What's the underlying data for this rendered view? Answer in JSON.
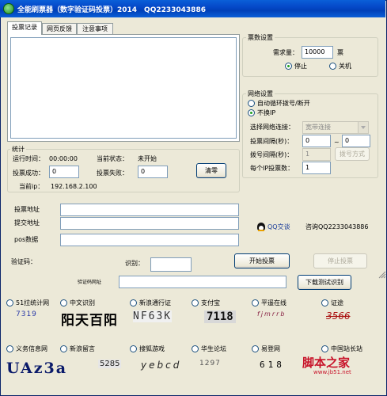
{
  "window": {
    "title": "全能刷票器（数字验证码投票）2014　QQ2233043886"
  },
  "tabs": [
    {
      "label": "投票记录"
    },
    {
      "label": "网页反馈"
    },
    {
      "label": "注意事项"
    }
  ],
  "vote_settings": {
    "title": "票数设置",
    "required_label": "需求量：",
    "required_value": "10000",
    "unit": "票",
    "opt_stop": "停止",
    "opt_shutdown": "关机"
  },
  "network": {
    "title": "网络设置",
    "opt_auto_redial": "自动循环拨号/断开",
    "opt_no_ip_change": "不换IP",
    "select_label": "选择网络连接：",
    "select_value": "宽带连接",
    "interval_label": "投票间隔(秒)：",
    "interval_from": "0",
    "tilde": "~",
    "interval_to": "0",
    "dial_label": "拨号间隔(秒)：",
    "dial_value": "1",
    "dial_mode_button": "拨号方式",
    "per_ip_label": "每个IP投票数：",
    "per_ip_value": "1"
  },
  "stats": {
    "title": "统计",
    "runtime_label": "运行时间：",
    "runtime_value": "00:00:00",
    "state_label": "当前状态：",
    "state_value": "未开始",
    "success_label": "投票成功：",
    "success_value": "0",
    "fail_label": "投票失败：",
    "fail_value": "0",
    "clear_button": "清零",
    "ip_label": "当前ip：",
    "ip_value": "192.168.2.100"
  },
  "form": {
    "vote_url_label": "投票地址",
    "vote_url_value": "",
    "submit_url_label": "提交地址",
    "submit_url_value": "",
    "pos_label": "pos数据",
    "pos_value": "",
    "qq_button": "QQ交谈",
    "consult_text": "咨询QQ2233043886",
    "captcha_label": "验证码：",
    "recognize_label": "识别：",
    "recognize_value": "",
    "start_button": "开始投票",
    "stop_button": "停止投票",
    "captcha_url_label": "验证码网址",
    "captcha_url_value": "",
    "download_button": "下载测试识别"
  },
  "captcha_options": [
    {
      "label": "51拉统计网",
      "sample": "7319",
      "color": "#2a3aa8"
    },
    {
      "label": "中文识别",
      "sample": "阳天百阳",
      "color": "#000000"
    },
    {
      "label": "新浪通行证",
      "sample": "NF63K",
      "color": "#333333"
    },
    {
      "label": "支付宝",
      "sample": "7118",
      "color": "#111111"
    },
    {
      "label": "平遥在线",
      "sample": "fjmrrb",
      "color": "#882244"
    },
    {
      "label": "证途",
      "sample": "3566",
      "color": "#aa1111"
    },
    {
      "label": "义务信息网",
      "sample": "UAz3a",
      "color": "#0a1a6a"
    },
    {
      "label": "新浪留言",
      "sample": "5285",
      "color": "#222222"
    },
    {
      "label": "搜狐游戏",
      "sample": "yebcd",
      "color": "#222222"
    },
    {
      "label": "华生论坛",
      "sample": "1297",
      "color": "#555555"
    },
    {
      "label": "易登网",
      "sample": "618",
      "color": "#000000"
    },
    {
      "label": "中国站长站",
      "sample": "",
      "color": "#000000"
    }
  ],
  "watermark": {
    "main": "脚本之家",
    "sub": "www.jb51.net"
  }
}
